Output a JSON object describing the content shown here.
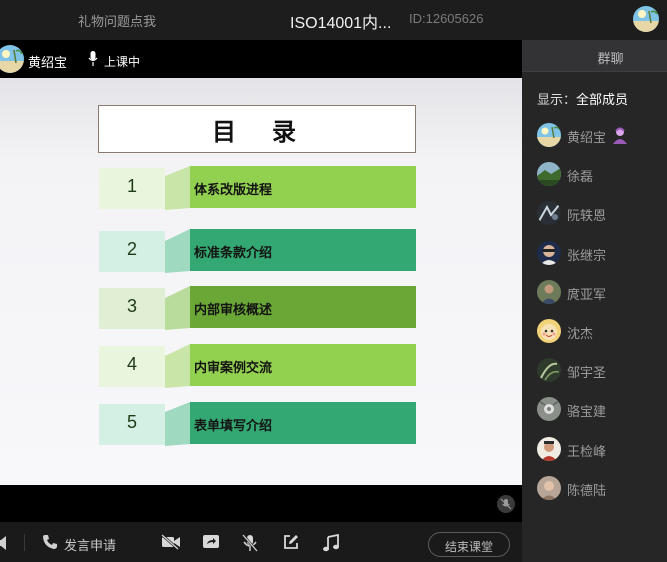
{
  "topbar": {
    "gift_text": "礼物问题点我",
    "title": "ISO14001内...",
    "room_id": "ID:12605626"
  },
  "teacher": {
    "name": "黄绍宝",
    "status": "上课中"
  },
  "slide": {
    "heading": "目录",
    "items": [
      {
        "num": "1",
        "label": "体系改版进程",
        "num_bg": "#e9f5dc",
        "fold": "#c9e6a8",
        "bar": "#92d050"
      },
      {
        "num": "2",
        "label": "标准条款介绍",
        "num_bg": "#d4efe3",
        "fold": "#9fd9bf",
        "bar": "#34a872"
      },
      {
        "num": "3",
        "label": "内部审核概述",
        "num_bg": "#e0efd3",
        "fold": "#b9dc9c",
        "bar": "#6aa737"
      },
      {
        "num": "4",
        "label": "内审案例交流",
        "num_bg": "#e9f5dc",
        "fold": "#c9e6a8",
        "bar": "#92d050"
      },
      {
        "num": "5",
        "label": "表单填写介绍",
        "num_bg": "#d4efe3",
        "fold": "#9fd9bf",
        "bar": "#34a872"
      }
    ]
  },
  "toolbar": {
    "request_label": "发言申请",
    "end_button": "结束课堂"
  },
  "panel": {
    "tab_label": "群聊",
    "filter_label": "显示：",
    "filter_value": "全部成员",
    "members": [
      {
        "name": "黄绍宝",
        "avatar": "beach",
        "host": true
      },
      {
        "name": "徐磊",
        "avatar": "landscape"
      },
      {
        "name": "阮轶恩",
        "avatar": "dark"
      },
      {
        "name": "张继宗",
        "avatar": "face"
      },
      {
        "name": "庹亚军",
        "avatar": "outdoor"
      },
      {
        "name": "沈杰",
        "avatar": "cartoon"
      },
      {
        "name": "邹宇圣",
        "avatar": "plant"
      },
      {
        "name": "骆宝建",
        "avatar": "flower"
      },
      {
        "name": "王检峰",
        "avatar": "person"
      },
      {
        "name": "陈德陆",
        "avatar": "soft"
      }
    ]
  },
  "colors": {
    "accent_green": "#92d050",
    "teal": "#34a872",
    "panel_bg": "#262626"
  }
}
